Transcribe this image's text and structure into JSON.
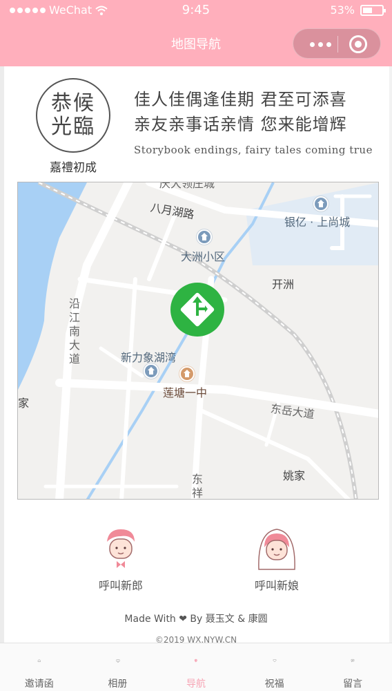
{
  "status_bar": {
    "carrier": "WeChat",
    "time": "9:45",
    "battery": "53%"
  },
  "nav": {
    "title": "地图导航"
  },
  "colors": {
    "brand_pink": "#ffafbc",
    "tab_active": "#f7a4b4",
    "marker_green": "#2eb342",
    "water_blue": "#a8d0f5"
  },
  "header": {
    "seal_line1": "恭候",
    "seal_line2": "光臨",
    "seal_caption": "嘉禮初成",
    "poem_line1": "佳人佳偶逢佳期  君至可添喜",
    "poem_line2": "亲友亲事话亲情  您来能增辉",
    "tagline": "Storybook endings, fairy tales coming true"
  },
  "map": {
    "labels": {
      "road_top": "八月湖路",
      "cut_top": "庆大领庄城",
      "mall": "银亿 · 上尚城",
      "district1": "大洲小区",
      "district2": "开洲",
      "road_left": "沿江南大道",
      "community": "新力象湖湾",
      "school": "莲塘一中",
      "road_right": "东岳大道",
      "edge_left": "家",
      "village": "姚家",
      "road_bottom": "东祥"
    },
    "marker_icon": "navigation-arrow-icon"
  },
  "calls": {
    "groom": "呼叫新郎",
    "bride": "呼叫新娘"
  },
  "footer": {
    "made_with": "Made With ❤ By 聂玉文 & 康圆",
    "copyright": "©2019 WX.NYW.CN"
  },
  "tabs": [
    {
      "label": "邀请函",
      "icon": "home-icon"
    },
    {
      "label": "相册",
      "icon": "album-icon"
    },
    {
      "label": "导航",
      "icon": "location-pin-icon"
    },
    {
      "label": "祝福",
      "icon": "heart-icon"
    },
    {
      "label": "留言",
      "icon": "message-icon"
    }
  ]
}
